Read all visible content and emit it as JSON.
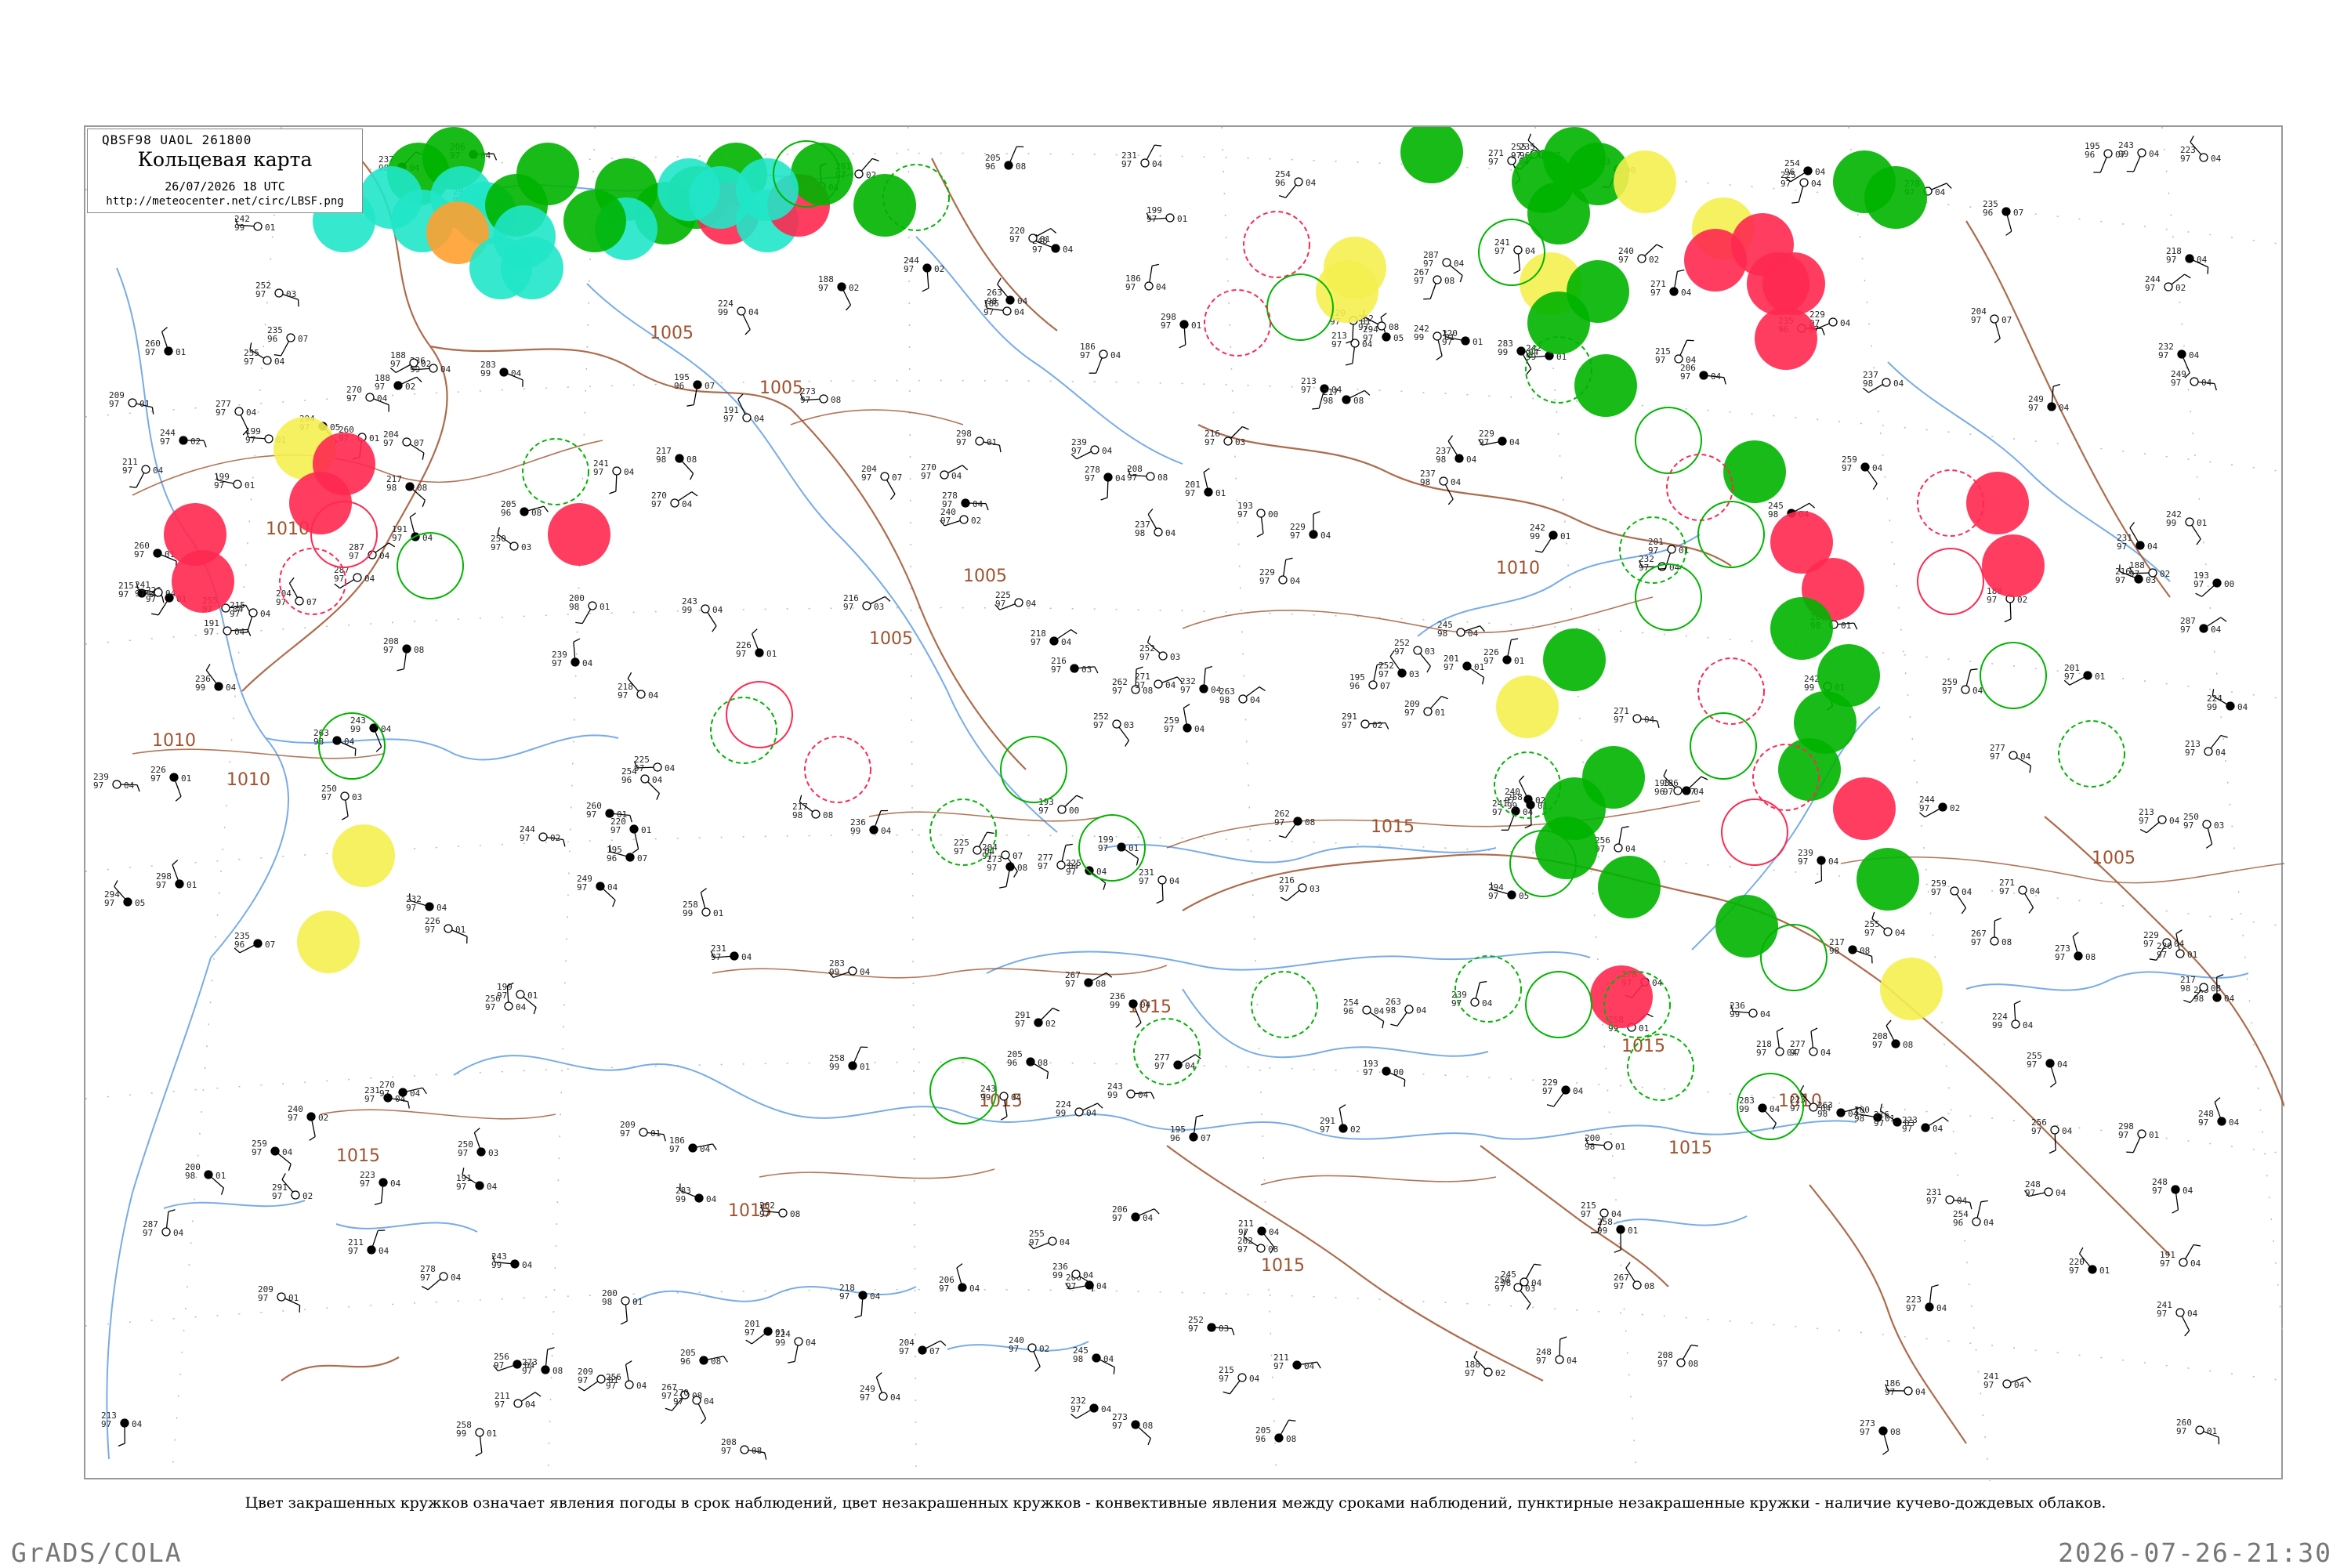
{
  "header": {
    "code": "QBSF98  UAOL  261800",
    "title": "Кольцевая карта",
    "datetime": "26/07/2026 18 UTC",
    "url": "http://meteocenter.net/circ/LBSF.png"
  },
  "caption": "Цвет закрашенных кружков означает явления погоды в срок наблюдений, цвет незакрашенных кружков - конвективные явления между сроками наблюдений, пунктирные незакрашенные кружки - наличие кучево-дождевых облаков.",
  "footer": {
    "left": "GrADS/COLA",
    "right": "2026-07-26-21:30"
  },
  "isobar_labels": [
    "1010",
    "1005",
    "1010",
    "1005",
    "1005",
    "1010",
    "1010",
    "1015",
    "1005",
    "1015",
    "1015",
    "1015",
    "1015",
    "1015",
    "1015",
    "1010",
    "1005",
    "1015"
  ],
  "colors": {
    "thunderstorm": "#00b400",
    "shower": "#ff2850",
    "rain": "#f5f050",
    "snow": "#ffa030",
    "drizzle": "#20e6c8",
    "coast": "#4a90e2",
    "isobar": "#a0522d",
    "border": "#777777"
  },
  "stations": [
    {
      "t": "231",
      "p": "97",
      "c": "04"
    },
    {
      "t": "193",
      "p": "97",
      "c": "00"
    },
    {
      "t": "195",
      "p": "96",
      "c": "07"
    },
    {
      "t": "241",
      "p": "97",
      "c": "04"
    },
    {
      "t": "242",
      "p": "99",
      "c": "01"
    },
    {
      "t": "270",
      "p": "97",
      "c": "04"
    },
    {
      "t": "243",
      "p": "99",
      "c": "04"
    },
    {
      "t": "273",
      "p": "97",
      "c": "08"
    },
    {
      "t": "258",
      "p": "99",
      "c": "01"
    },
    {
      "t": "229",
      "p": "97",
      "c": "04"
    },
    {
      "t": "216",
      "p": "97",
      "c": "03"
    },
    {
      "t": "200",
      "p": "98",
      "c": "01"
    },
    {
      "t": "252",
      "p": "97",
      "c": "03"
    },
    {
      "t": "204",
      "p": "97",
      "c": "07"
    },
    {
      "t": "236",
      "p": "99",
      "c": "04"
    },
    {
      "t": "188",
      "p": "97",
      "c": "02"
    },
    {
      "t": "255",
      "p": "97",
      "c": "04"
    },
    {
      "t": "217",
      "p": "98",
      "c": "08"
    },
    {
      "t": "186",
      "p": "97",
      "c": "04"
    },
    {
      "t": "220",
      "p": "97",
      "c": "01"
    },
    {
      "t": "254",
      "p": "96",
      "c": "04"
    },
    {
      "t": "239",
      "p": "97",
      "c": "04"
    },
    {
      "t": "267",
      "p": "97",
      "c": "08"
    },
    {
      "t": "291",
      "p": "97",
      "c": "02"
    },
    {
      "t": "206",
      "p": "97",
      "c": "04"
    },
    {
      "t": "223",
      "p": "97",
      "c": "04"
    },
    {
      "t": "260",
      "p": "97",
      "c": "01"
    },
    {
      "t": "245",
      "p": "98",
      "c": "04"
    },
    {
      "t": "294",
      "p": "97",
      "c": "05"
    },
    {
      "t": "211",
      "p": "97",
      "c": "04"
    },
    {
      "t": "199",
      "p": "97",
      "c": "01"
    },
    {
      "t": "215",
      "p": "97",
      "c": "04"
    },
    {
      "t": "235",
      "p": "96",
      "c": "07"
    },
    {
      "t": "287",
      "p": "97",
      "c": "04"
    },
    {
      "t": "262",
      "p": "97",
      "c": "08"
    },
    {
      "t": "224",
      "p": "99",
      "c": "04"
    },
    {
      "t": "278",
      "p": "97",
      "c": "04"
    },
    {
      "t": "209",
      "p": "97",
      "c": "01"
    },
    {
      "t": "250",
      "p": "97",
      "c": "03"
    },
    {
      "t": "218",
      "p": "97",
      "c": "04"
    },
    {
      "t": "263",
      "p": "98",
      "c": "04"
    },
    {
      "t": "240",
      "p": "97",
      "c": "02"
    },
    {
      "t": "232",
      "p": "97",
      "c": "04"
    },
    {
      "t": "277",
      "p": "97",
      "c": "04"
    },
    {
      "t": "205",
      "p": "96",
      "c": "08"
    },
    {
      "t": "248",
      "p": "97",
      "c": "04"
    },
    {
      "t": "226",
      "p": "97",
      "c": "01"
    },
    {
      "t": "259",
      "p": "97",
      "c": "04"
    },
    {
      "t": "191",
      "p": "97",
      "c": "04"
    },
    {
      "t": "283",
      "p": "99",
      "c": "04"
    },
    {
      "t": "244",
      "p": "97",
      "c": "02"
    },
    {
      "t": "213",
      "p": "97",
      "c": "04"
    },
    {
      "t": "256",
      "p": "97",
      "c": "04"
    },
    {
      "t": "201",
      "p": "97",
      "c": "01"
    },
    {
      "t": "237",
      "p": "98",
      "c": "04"
    },
    {
      "t": "271",
      "p": "97",
      "c": "04"
    },
    {
      "t": "208",
      "p": "97",
      "c": "08"
    },
    {
      "t": "249",
      "p": "97",
      "c": "04"
    },
    {
      "t": "225",
      "p": "97",
      "c": "04"
    },
    {
      "t": "298",
      "p": "97",
      "c": "01"
    }
  ]
}
